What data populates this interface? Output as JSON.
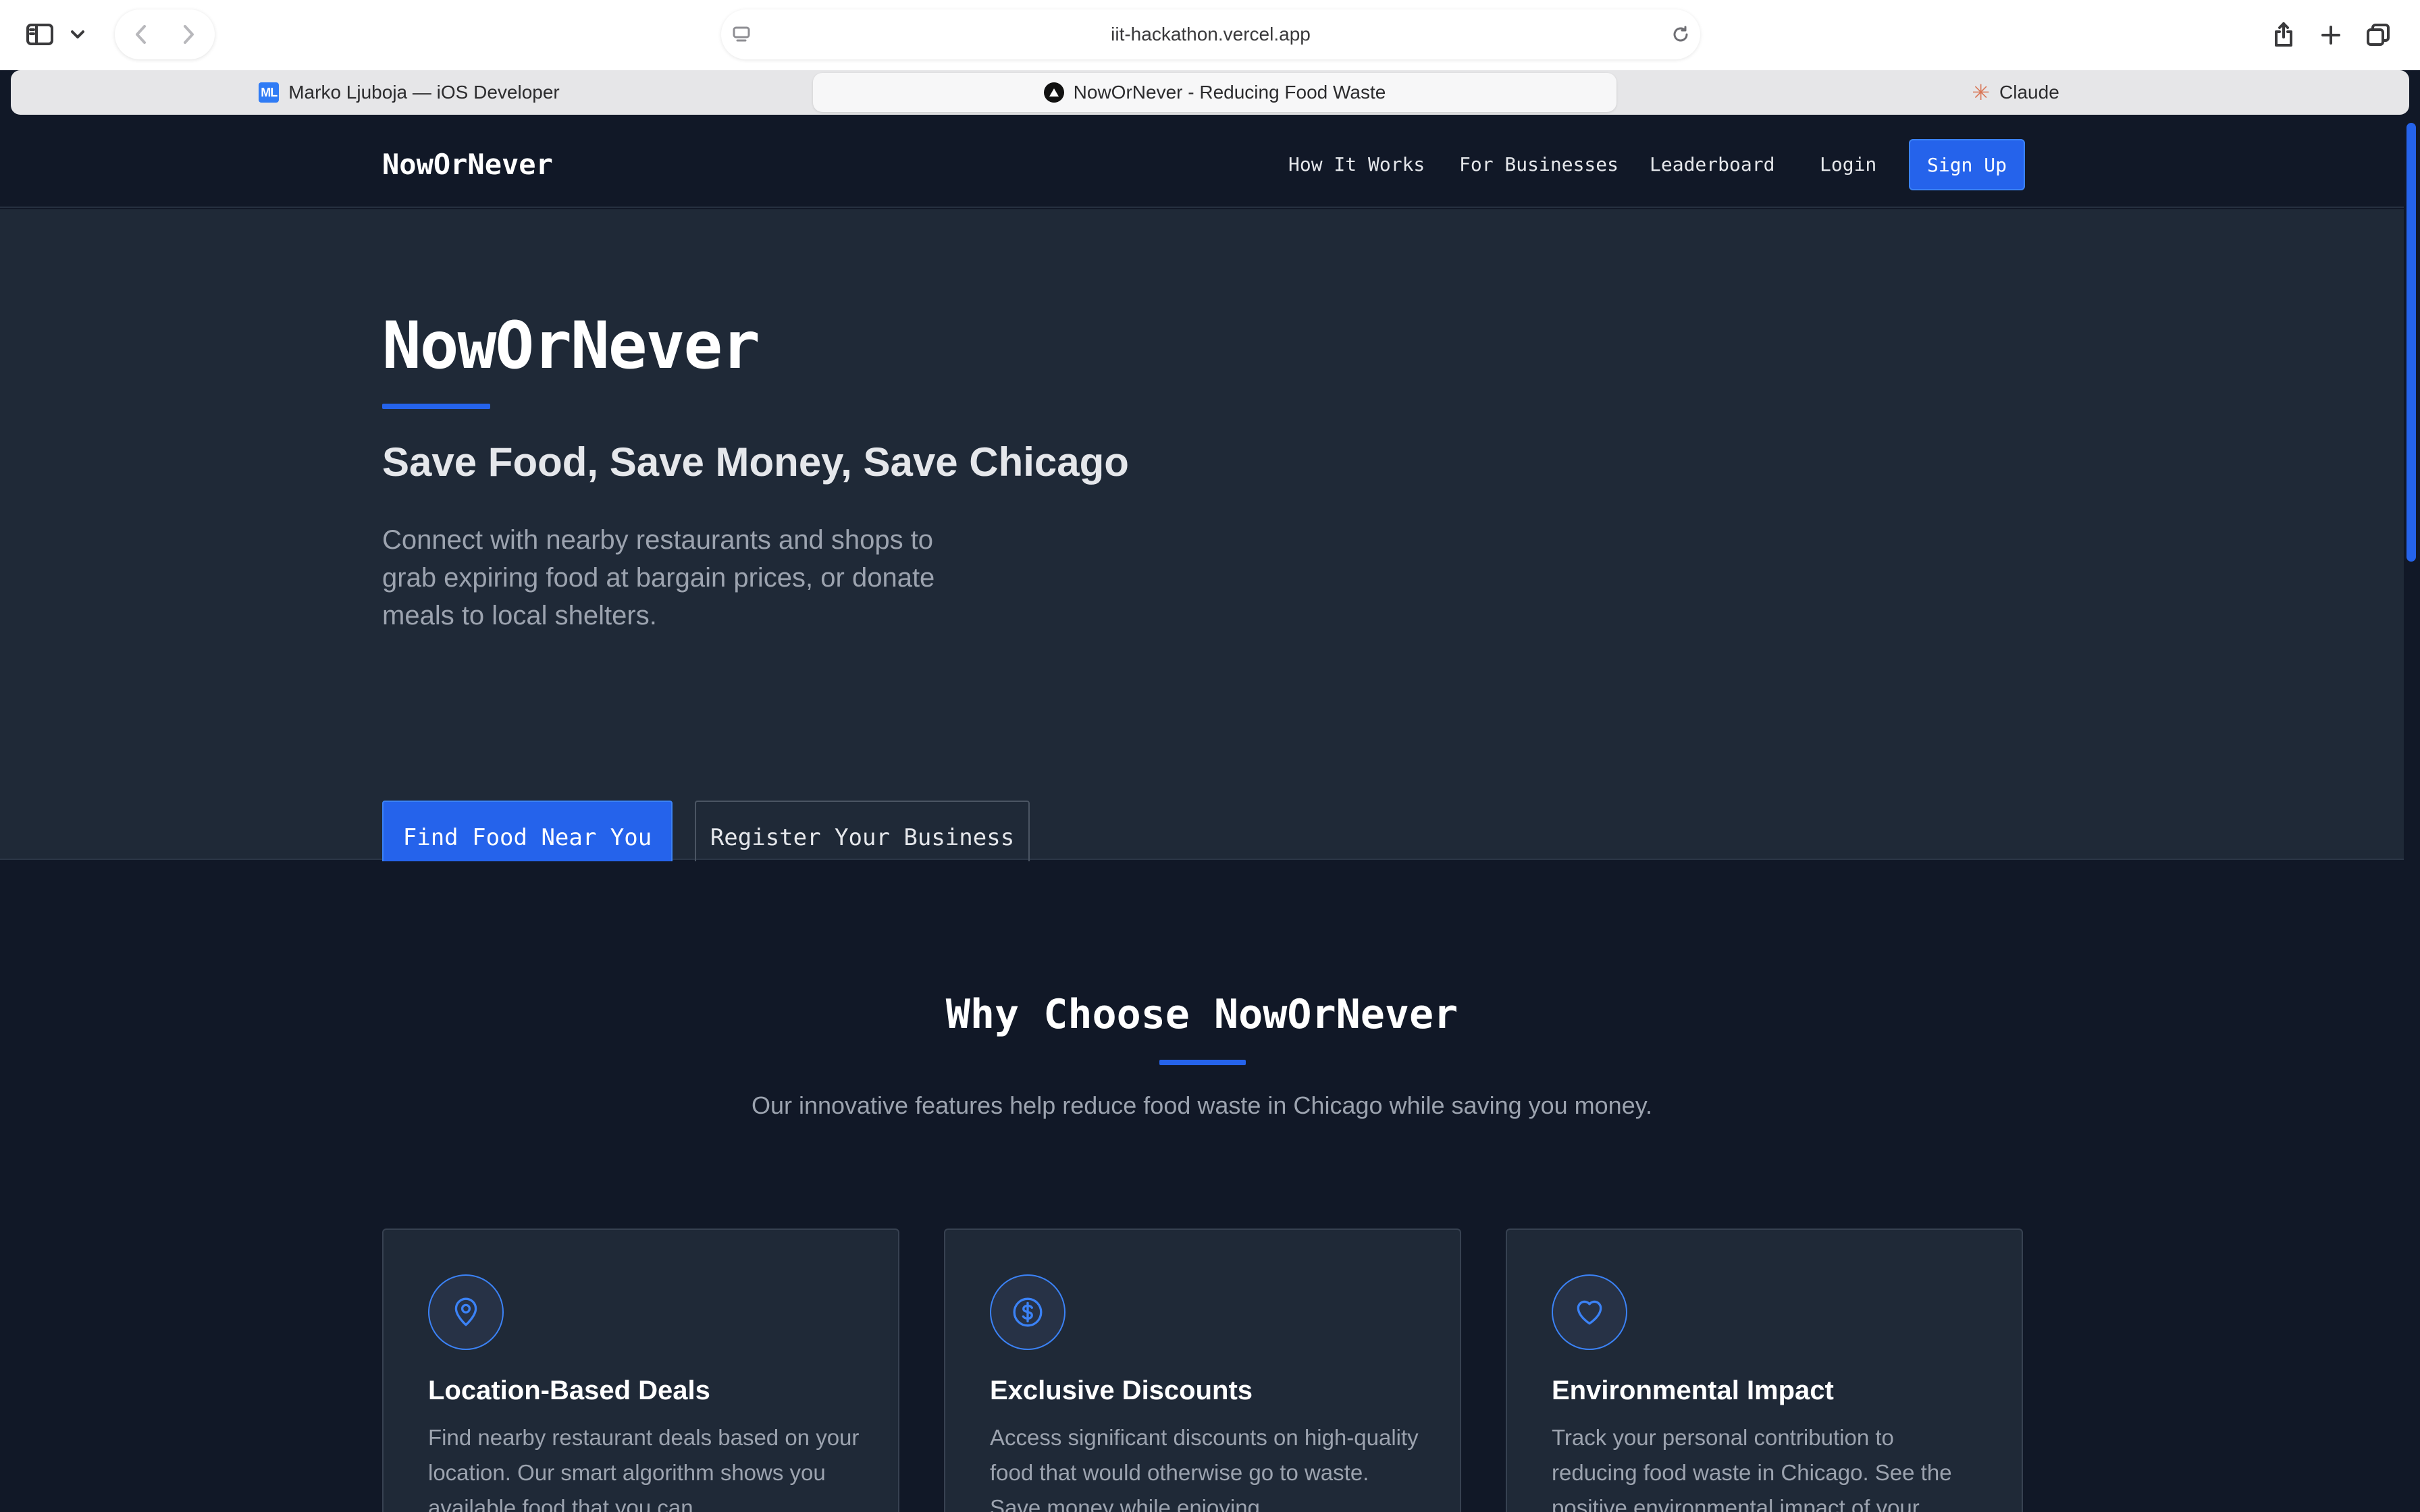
{
  "browser": {
    "url": "iit-hackathon.vercel.app",
    "tabs": [
      {
        "label": "Marko Ljuboja — iOS Developer",
        "favicon_text": "ML"
      },
      {
        "label": "NowOrNever - Reducing Food Waste"
      },
      {
        "label": "Claude"
      }
    ]
  },
  "nav": {
    "brand": "NowOrNever",
    "links": [
      "How It Works",
      "For Businesses",
      "Leaderboard",
      "Login"
    ],
    "signup": "Sign Up"
  },
  "hero": {
    "title": "NowOrNever",
    "subtitle": "Save Food, Save Money, Save Chicago",
    "description": "Connect with nearby restaurants and shops to grab expiring food at bargain prices, or donate meals to local shelters.",
    "primary_button": "Find Food Near You",
    "secondary_button": "Register Your Business"
  },
  "features": {
    "title": "Why Choose NowOrNever",
    "description": "Our innovative features help reduce food waste in Chicago while saving you money.",
    "cards": [
      {
        "icon": "map-pin-icon",
        "title": "Location-Based Deals",
        "description": "Find nearby restaurant deals based on your location. Our smart algorithm shows you available food that you can"
      },
      {
        "icon": "dollar-icon",
        "title": "Exclusive Discounts",
        "description": "Access significant discounts on high-quality food that would otherwise go to waste. Save money while enjoying"
      },
      {
        "icon": "heart-icon",
        "title": "Environmental Impact",
        "description": "Track your personal contribution to reducing food waste in Chicago. See the positive environmental impact of your"
      }
    ]
  },
  "colors": {
    "accent": "#2563eb",
    "page_bg": "#111827",
    "hero_bg": "#1f2937"
  }
}
